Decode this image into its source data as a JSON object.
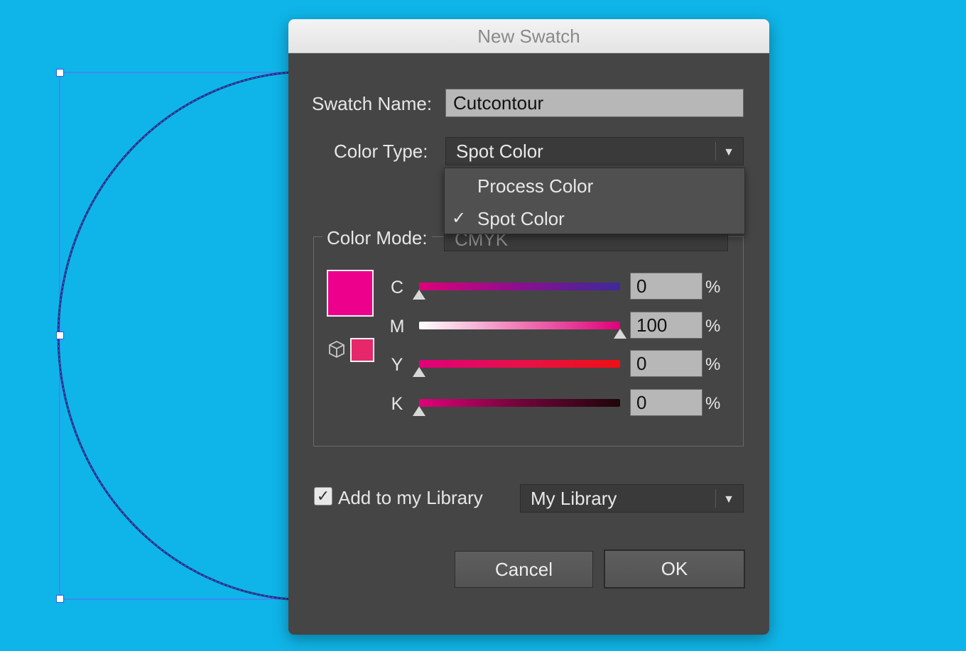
{
  "dialog": {
    "title": "New Swatch",
    "swatch_name_label": "Swatch Name:",
    "swatch_name_value": "Cutcontour",
    "color_type_label": "Color Type:",
    "color_type_value": "Spot Color",
    "color_type_options": [
      {
        "label": "Process Color",
        "checked": false
      },
      {
        "label": "Spot Color",
        "checked": true
      }
    ],
    "color_mode_label": "Color Mode:",
    "color_mode_value": "CMYK",
    "swatch_color": "#ec008c",
    "sliders": [
      {
        "channel": "C",
        "value": "0",
        "level": 0
      },
      {
        "channel": "M",
        "value": "100",
        "level": 1
      },
      {
        "channel": "Y",
        "value": "0",
        "level": 0
      },
      {
        "channel": "K",
        "value": "0",
        "level": 0
      }
    ],
    "percent_sign": "%",
    "add_to_library_label": "Add to my Library",
    "add_to_library_checked": true,
    "library_value": "My Library",
    "cancel_label": "Cancel",
    "ok_label": "OK"
  },
  "icons": {
    "dropdown": "chevron-down-icon",
    "checkmark": "checkmark-icon",
    "out_of_gamut": "cube-icon"
  },
  "colors": {
    "canvas_background": "#0fb5e8",
    "dialog_background": "#454545",
    "selection_blue": "#3b5bdb"
  }
}
